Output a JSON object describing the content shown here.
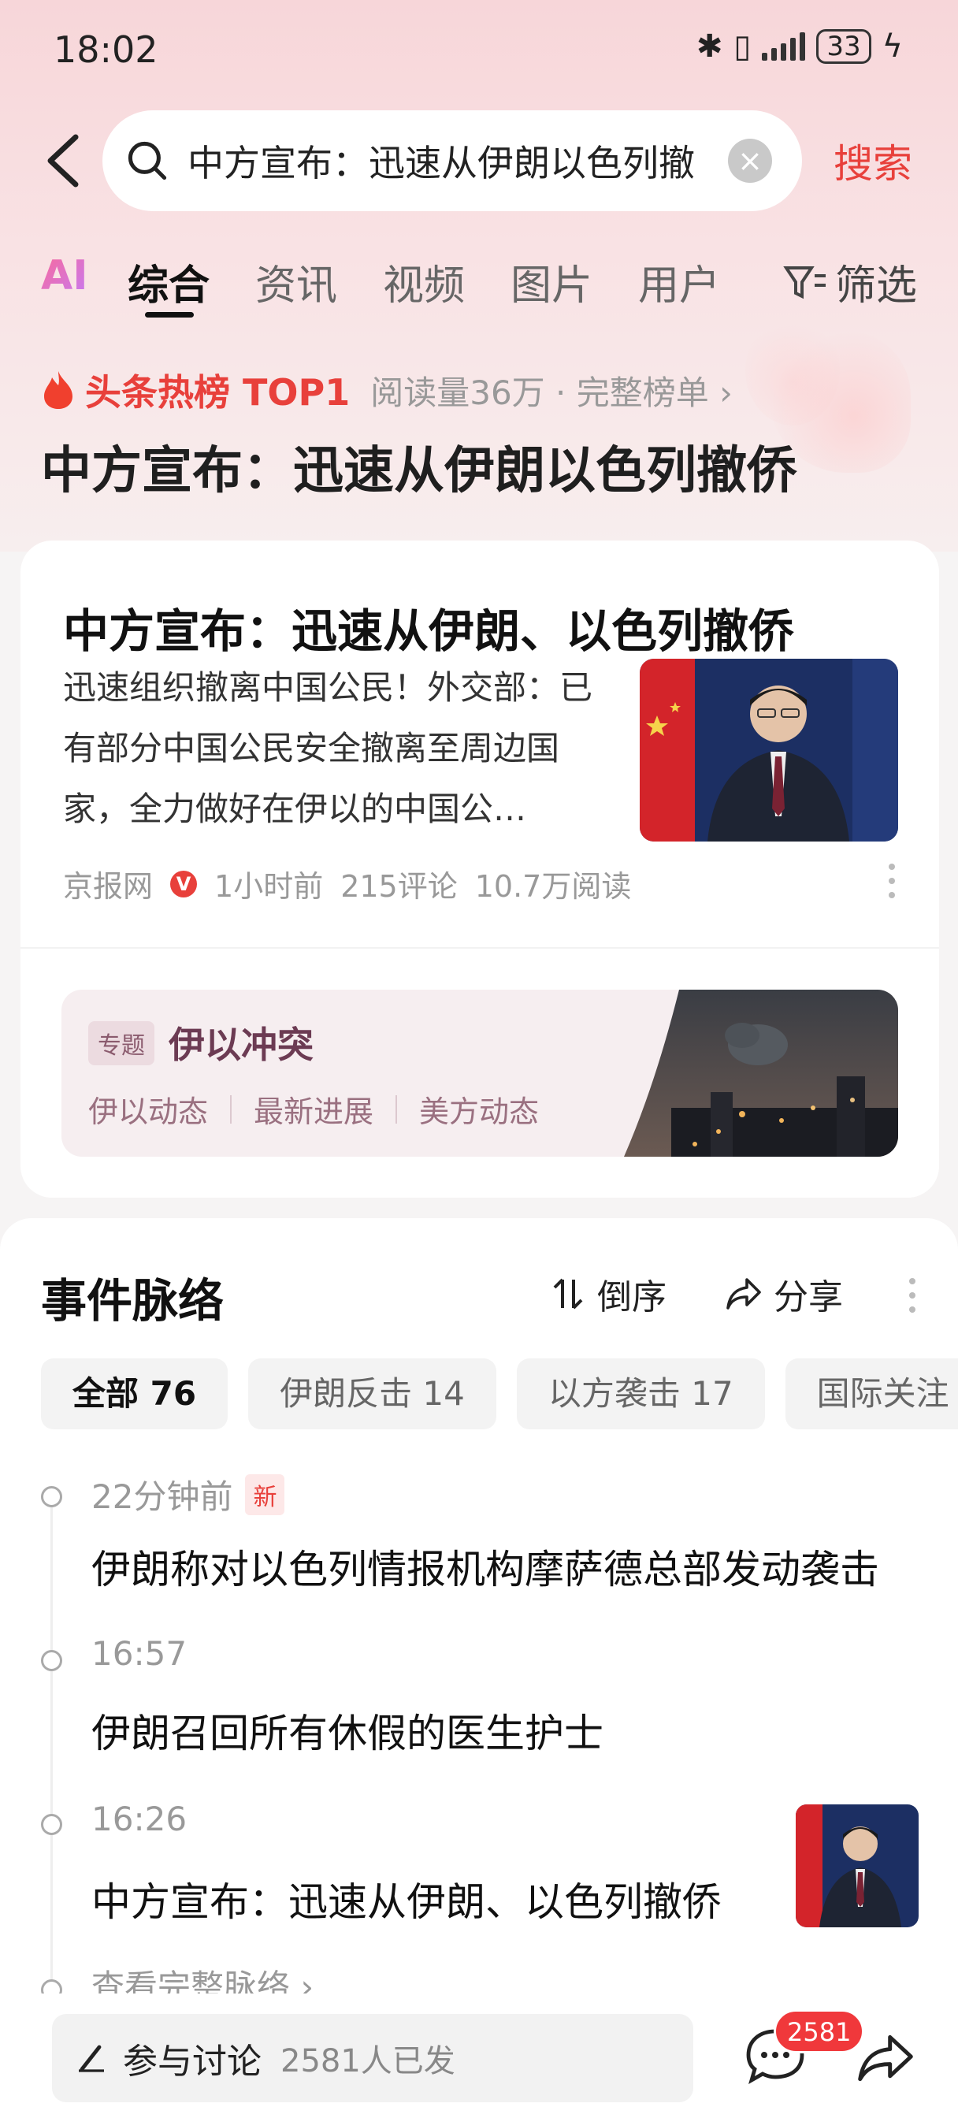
{
  "status_bar": {
    "time": "18:02",
    "battery": "33"
  },
  "search": {
    "query": "中方宣布：迅速从伊朗以色列撤",
    "submit_label": "搜索"
  },
  "tabs": [
    {
      "label": "AI"
    },
    {
      "label": "综合"
    },
    {
      "label": "资讯"
    },
    {
      "label": "视频"
    },
    {
      "label": "图片"
    },
    {
      "label": "用户"
    }
  ],
  "filter_label": "筛选",
  "hot": {
    "label": "头条热榜 TOP1",
    "meta": "阅读量36万 · 完整榜单 ›",
    "title": "中方宣布：迅速从伊朗以色列撤侨"
  },
  "news_card": {
    "title": "中方宣布：迅速从伊朗、以色列撤侨",
    "summary": "迅速组织撤离中国公民！外交部：已有部分中国公民安全撤离至周边国家，全力做好在伊以的中国公…",
    "source": "京报网",
    "time": "1小时前",
    "comments": "215评论",
    "reads": "10.7万阅读"
  },
  "topic": {
    "tag": "专题",
    "name": "伊以冲突",
    "links": [
      "伊以动态",
      "最新进展",
      "美方动态"
    ]
  },
  "timeline": {
    "title": "事件脉络",
    "sort_label": "倒序",
    "share_label": "分享",
    "filters": [
      "全部 76",
      "伊朗反击 14",
      "以方袭击 17",
      "国际关注"
    ],
    "items": [
      {
        "time": "22分钟前",
        "badge": "新",
        "text": "伊朗称对以色列情报机构摩萨德总部发动袭击"
      },
      {
        "time": "16:57",
        "text": "伊朗召回所有休假的医生护士"
      },
      {
        "time": "16:26",
        "text": "中方宣布：迅速从伊朗、以色列撤侨"
      }
    ],
    "more_label": "查看完整脉络 ›"
  },
  "bottom": {
    "discuss_label": "参与讨论",
    "discuss_count": "2581人已发",
    "comment_badge": "2581"
  }
}
